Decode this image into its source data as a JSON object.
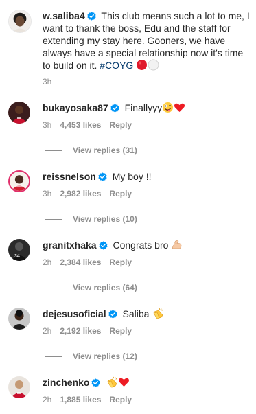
{
  "caption": {
    "username": "w.saliba4",
    "text": "This club means such a lot to me, I want to thank the boss, Edu and the staff for extending my stay here. Gooners, we have always have a special relationship now it's time to build on it.",
    "hashtag": "#COYG",
    "time": "3h"
  },
  "comments": [
    {
      "username": "bukayosaka87",
      "text": "Finallyyy",
      "emoji": [
        "zany-face-icon",
        "red-heart-icon"
      ],
      "time": "3h",
      "likes": "4,453 likes",
      "reply": "Reply",
      "view_replies": "View replies (31)"
    },
    {
      "username": "reissnelson",
      "text": "My boy !!",
      "emoji": [],
      "time": "3h",
      "likes": "2,982 likes",
      "reply": "Reply",
      "view_replies": "View replies (10)"
    },
    {
      "username": "granitxhaka",
      "text": "Congrats bro",
      "emoji": [
        "flexed-biceps-icon"
      ],
      "time": "2h",
      "likes": "2,384 likes",
      "reply": "Reply",
      "view_replies": "View replies (64)"
    },
    {
      "username": "dejesusoficial",
      "text": "Saliba",
      "emoji": [
        "clapping-hands-icon"
      ],
      "time": "2h",
      "likes": "2,192 likes",
      "reply": "Reply",
      "view_replies": "View replies (12)"
    },
    {
      "username": "zinchenko",
      "text": "",
      "emoji": [
        "clapping-hands-icon",
        "red-heart-icon"
      ],
      "time": "2h",
      "likes": "1,885 likes",
      "reply": "Reply",
      "view_replies": ""
    }
  ],
  "colors": {
    "text": "#262626",
    "meta": "#8e8e8e",
    "verified": "#0095f6",
    "hashtag": "#00376b",
    "heart": "#ed1c24"
  }
}
